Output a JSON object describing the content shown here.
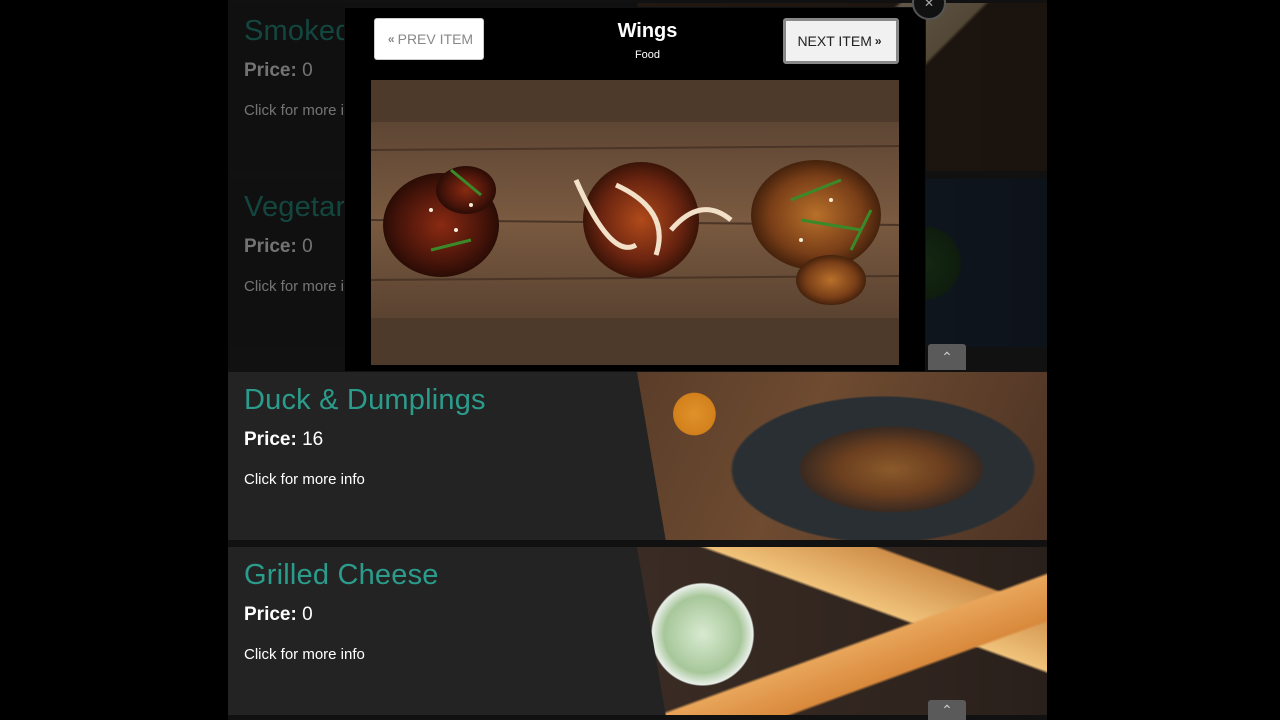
{
  "colors": {
    "accent": "#2b9c8c",
    "card_bg": "#232323",
    "modal_bg": "#000000"
  },
  "background_cards": [
    {
      "title": "Smoked",
      "price_label": "Price:",
      "price": "0",
      "more": "Click for more info"
    },
    {
      "title": "Vegetar",
      "price_label": "Price:",
      "price": "0",
      "more": "Click for more info"
    }
  ],
  "cards": [
    {
      "title": "Duck & Dumplings",
      "price_label": "Price:",
      "price": "16",
      "more": "Click for more info"
    },
    {
      "title": "Grilled Cheese",
      "price_label": "Price:",
      "price": "0",
      "more": "Click for more info"
    }
  ],
  "modal": {
    "title": "Wings",
    "category": "Food",
    "prev_label": "PREV ITEM",
    "next_label": "NEXT ITEM",
    "prev_icon": "double-chevron-left-icon",
    "next_icon": "double-chevron-right-icon",
    "close_icon": "close-icon"
  },
  "scroll_top_icon": "chevron-up-icon"
}
